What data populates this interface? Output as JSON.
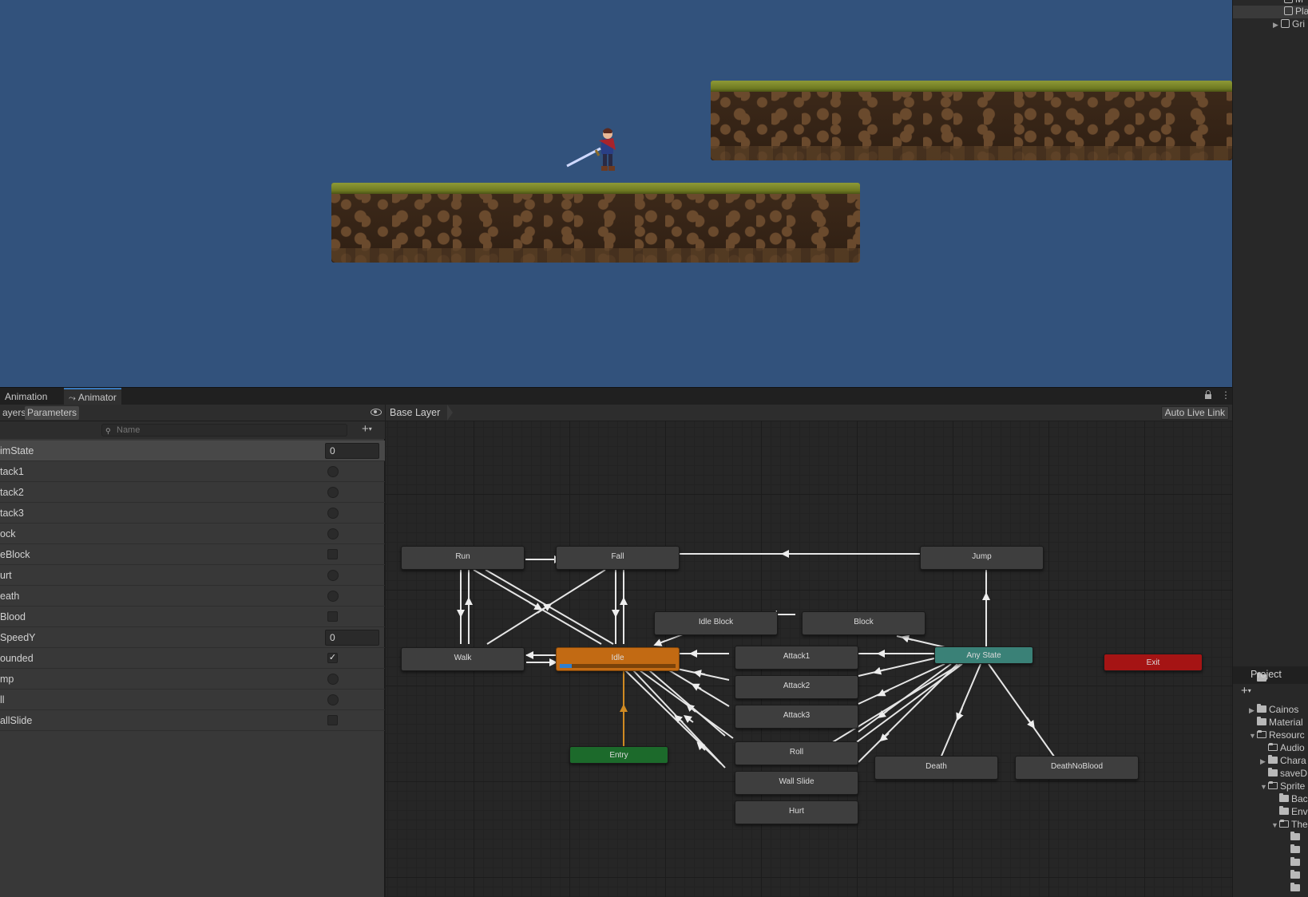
{
  "hierarchy": {
    "items": [
      {
        "label": "M"
      },
      {
        "label": "Pla"
      },
      {
        "label": "Gri"
      }
    ]
  },
  "tabs": {
    "animation": "Animation",
    "animator": "Animator"
  },
  "params": {
    "tab_layers": "ayers",
    "tab_parameters": "Parameters",
    "search_placeholder": "Name",
    "rows": [
      {
        "name": "imState",
        "type": "int",
        "value": "0"
      },
      {
        "name": "tack1",
        "type": "trigger"
      },
      {
        "name": "tack2",
        "type": "trigger"
      },
      {
        "name": "tack3",
        "type": "trigger"
      },
      {
        "name": "ock",
        "type": "trigger"
      },
      {
        "name": "eBlock",
        "type": "bool",
        "checked": false
      },
      {
        "name": "urt",
        "type": "trigger"
      },
      {
        "name": "eath",
        "type": "trigger"
      },
      {
        "name": "Blood",
        "type": "bool",
        "checked": false
      },
      {
        "name": "SpeedY",
        "type": "float",
        "value": "0"
      },
      {
        "name": "ounded",
        "type": "bool",
        "checked": true
      },
      {
        "name": "mp",
        "type": "trigger"
      },
      {
        "name": "ll",
        "type": "trigger"
      },
      {
        "name": "allSlide",
        "type": "bool",
        "checked": false
      }
    ]
  },
  "graph": {
    "breadcrumb": "Base Layer",
    "live_link_label": "Auto Live Link",
    "states": {
      "run": "Run",
      "fall": "Fall",
      "jump": "Jump",
      "idle_block": "Idle Block",
      "block": "Block",
      "walk": "Walk",
      "idle": "Idle",
      "attack1": "Attack1",
      "attack2": "Attack2",
      "attack3": "Attack3",
      "any_state": "Any State",
      "exit": "Exit",
      "entry": "Entry",
      "roll": "Roll",
      "wall_slide": "Wall Slide",
      "hurt": "Hurt",
      "death": "Death",
      "death_no_blood": "DeathNoBlood"
    },
    "idle_progress": 0.1
  },
  "project": {
    "title": "Project",
    "items": [
      {
        "label": "Cainos"
      },
      {
        "label": "Material"
      },
      {
        "label": "Resourc"
      },
      {
        "label": "Audio"
      },
      {
        "label": "Chara"
      },
      {
        "label": "saveD"
      },
      {
        "label": "Sprite"
      },
      {
        "label": "Bac"
      },
      {
        "label": "Env"
      },
      {
        "label": "The"
      }
    ]
  },
  "colors": {
    "game_bg": "#32527c",
    "idle_state": "#c26a13",
    "any_state": "#3a8177",
    "entry_state": "#1c6a2b",
    "exit_state": "#a51414",
    "tab_accent": "#3a79bb"
  }
}
